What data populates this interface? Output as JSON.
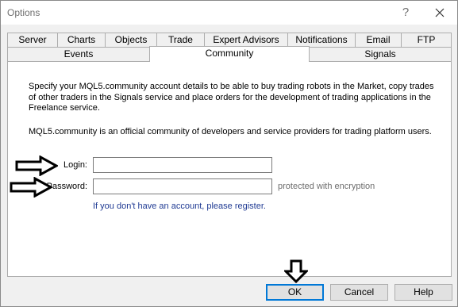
{
  "window": {
    "title": "Options",
    "help_glyph": "?",
    "close_icon": "close-icon"
  },
  "tabs": {
    "row1": [
      "Server",
      "Charts",
      "Objects",
      "Trade",
      "Expert Advisors",
      "Notifications",
      "Email",
      "FTP"
    ],
    "row2": [
      "Events",
      "Community",
      "Signals"
    ],
    "active": "Community"
  },
  "community": {
    "description": "Specify your MQL5.community account details to be able to buy trading robots in the Market, copy trades of other traders in the Signals service and place orders for the development of trading applications in the Freelance service.",
    "info": "MQL5.community is an official community of developers and service providers for trading platform users.",
    "login_label": "Login:",
    "login_value": "",
    "password_label": "Password:",
    "password_value": "",
    "password_hint": "protected with encryption",
    "register_link": "If you don't have an account, please register."
  },
  "buttons": {
    "ok": "OK",
    "cancel": "Cancel",
    "help": "Help"
  },
  "colors": {
    "link": "#1f3a93",
    "default_button_border": "#0078d7"
  }
}
